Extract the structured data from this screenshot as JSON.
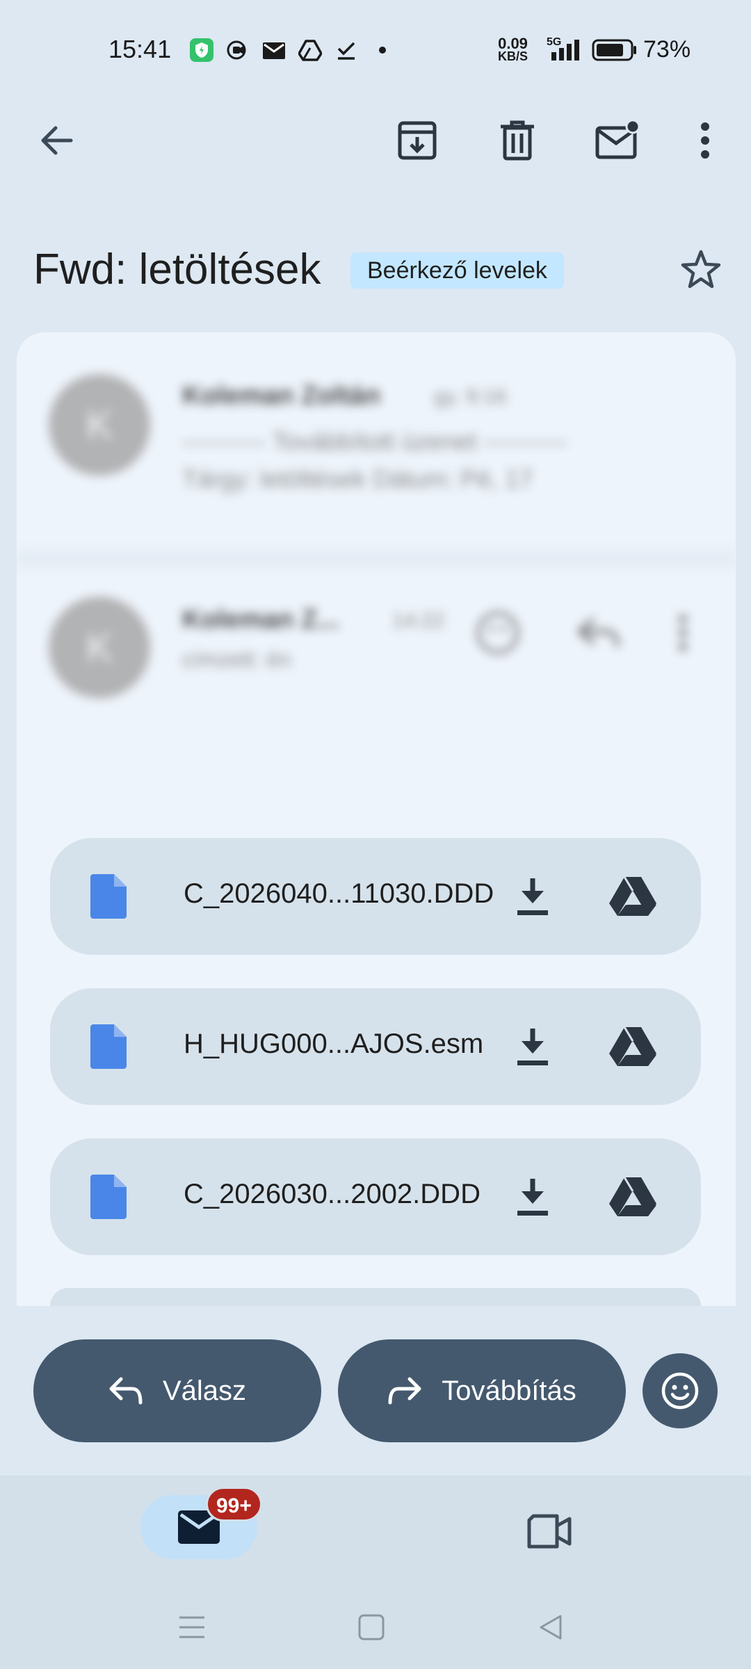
{
  "status_bar": {
    "time": "15:41",
    "net_speed_value": "0.09",
    "net_speed_unit": "KB/S",
    "network": "5G",
    "battery_pct": "73%",
    "notification_icons": [
      "shield-app-icon",
      "screen-record-icon",
      "mail-icon",
      "drive-icon",
      "task-check-icon",
      "more-dot-icon"
    ]
  },
  "toolbar": {
    "back_icon": "arrow-back-icon",
    "archive_icon": "archive-icon",
    "delete_icon": "trash-icon",
    "mark_unread_icon": "mark-unread-icon",
    "more_icon": "more-vert-icon"
  },
  "subject": {
    "title": "Fwd: letöltések",
    "label": "Beérkező levelek",
    "star_icon": "star-outline-icon"
  },
  "messages": [
    {
      "avatar_letter": "K",
      "sender": "Koleman Zoltán",
      "time": "gy. 9:16",
      "preview_line1": "---------- Továbbított üzenet ----------",
      "preview_line2": "Tárgy: letöltések Dátum: Pé, 17"
    },
    {
      "avatar_letter": "K",
      "sender": "Koleman Z...",
      "time": "14:22",
      "recipient": "címzett: én"
    }
  ],
  "attachments": [
    {
      "name": "C_2026040...11030.DDD"
    },
    {
      "name": "H_HUG000...AJOS.esm"
    },
    {
      "name": "C_2026030...2002.DDD"
    }
  ],
  "actions": {
    "reply": "Válasz",
    "forward": "Továbbítás"
  },
  "bottom_nav": {
    "mail_badge": "99+"
  },
  "colors": {
    "background": "#dde8f2",
    "card": "#eef4fb",
    "attachment_chip": "#d6e2eb",
    "label_chip": "#c2e7ff",
    "action_button": "#44596e",
    "badge": "#b3261e",
    "file_icon": "#4a86e8"
  }
}
